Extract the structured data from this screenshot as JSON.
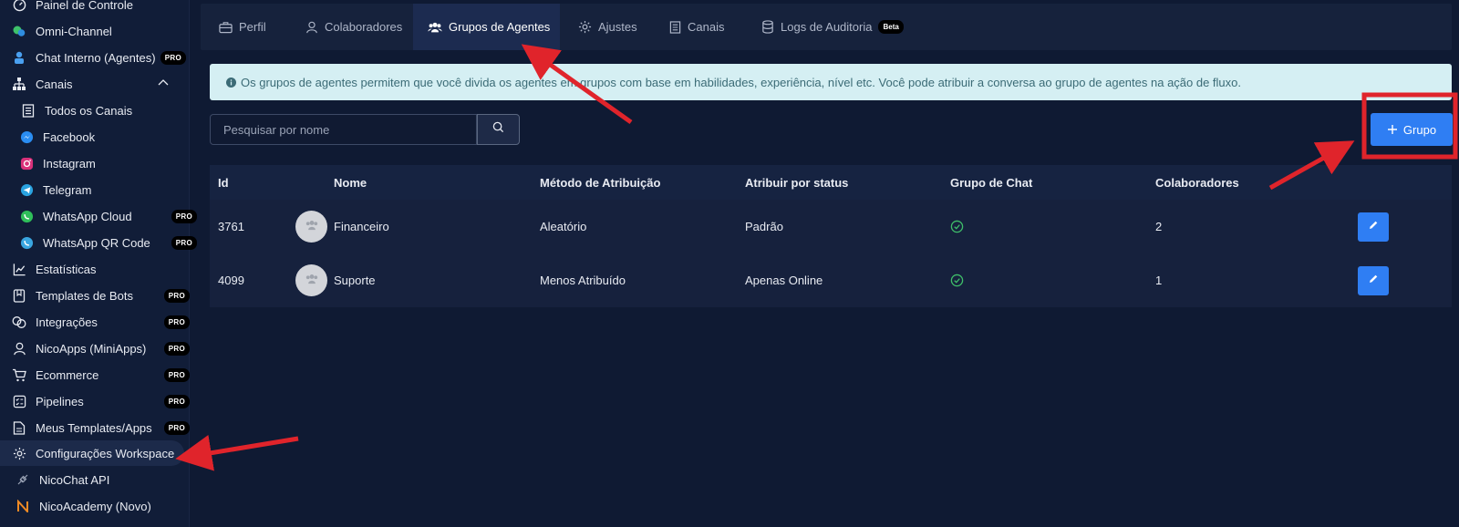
{
  "sidebar": {
    "items": [
      {
        "label": "Painel de Controle",
        "icon": "dashboard-icon",
        "pro": false
      },
      {
        "label": "Omni-Channel",
        "icon": "chat-bubbles-icon",
        "pro": false
      },
      {
        "label": "Chat Interno (Agentes)",
        "icon": "agent-icon",
        "pro": true
      },
      {
        "label": "Canais",
        "icon": "sitemap-icon",
        "pro": false,
        "expanded": true
      },
      {
        "label": "Todos os Canais",
        "icon": "list-icon",
        "pro": false
      },
      {
        "label": "Facebook",
        "icon": "messenger-icon",
        "pro": false
      },
      {
        "label": "Instagram",
        "icon": "instagram-icon",
        "pro": false
      },
      {
        "label": "Telegram",
        "icon": "telegram-icon",
        "pro": false
      },
      {
        "label": "WhatsApp Cloud",
        "icon": "whatsapp-icon",
        "pro": true
      },
      {
        "label": "WhatsApp QR Code",
        "icon": "whatsapp-qr-icon",
        "pro": true
      },
      {
        "label": "Estatísticas",
        "icon": "chart-icon",
        "pro": false
      },
      {
        "label": "Templates de Bots",
        "icon": "book-icon",
        "pro": true
      },
      {
        "label": "Integrações",
        "icon": "integration-icon",
        "pro": true
      },
      {
        "label": "NicoApps (MiniApps)",
        "icon": "user-icon",
        "pro": true
      },
      {
        "label": "Ecommerce",
        "icon": "cart-icon",
        "pro": true
      },
      {
        "label": "Pipelines",
        "icon": "checklist-icon",
        "pro": true
      },
      {
        "label": "Meus Templates/Apps",
        "icon": "document-icon",
        "pro": true
      },
      {
        "label": "Configurações Workspace",
        "icon": "gear-icon",
        "pro": false,
        "active": true
      },
      {
        "label": "NicoChat API",
        "icon": "plug-icon",
        "pro": false
      },
      {
        "label": "NicoAcademy (Novo)",
        "icon": "n-logo-icon",
        "pro": false
      }
    ],
    "pro_label": "PRO"
  },
  "tabs": [
    {
      "label": "Perfil",
      "icon": "briefcase-icon"
    },
    {
      "label": "Colaboradores",
      "icon": "user-icon"
    },
    {
      "label": "Grupos de Agentes",
      "icon": "users-icon",
      "active": true
    },
    {
      "label": "Ajustes",
      "icon": "gear-icon"
    },
    {
      "label": "Canais",
      "icon": "list-icon"
    },
    {
      "label": "Logs de Auditoria",
      "icon": "database-icon",
      "badge": "Beta"
    }
  ],
  "info_text": "Os grupos de agentes permitem que você divida os agentes em grupos com base em habilidades, experiência, nível etc. Você pode atribuir a conversa ao grupo de agentes na ação de fluxo.",
  "search": {
    "placeholder": "Pesquisar por nome"
  },
  "add_button": {
    "label": "Grupo"
  },
  "table": {
    "headers": [
      "Id",
      "Nome",
      "Método de Atribuição",
      "Atribuir por status",
      "Grupo de Chat",
      "Colaboradores"
    ],
    "rows": [
      {
        "id": "3761",
        "name": "Financeiro",
        "method": "Aleatório",
        "status": "Padrão",
        "chat_group": true,
        "members": "2"
      },
      {
        "id": "4099",
        "name": "Suporte",
        "method": "Menos Atribuído",
        "status": "Apenas Online",
        "chat_group": true,
        "members": "1"
      }
    ]
  },
  "colors": {
    "accent": "#2f7ef3",
    "annotation": "#e0242b",
    "check": "#3fbf6a"
  }
}
